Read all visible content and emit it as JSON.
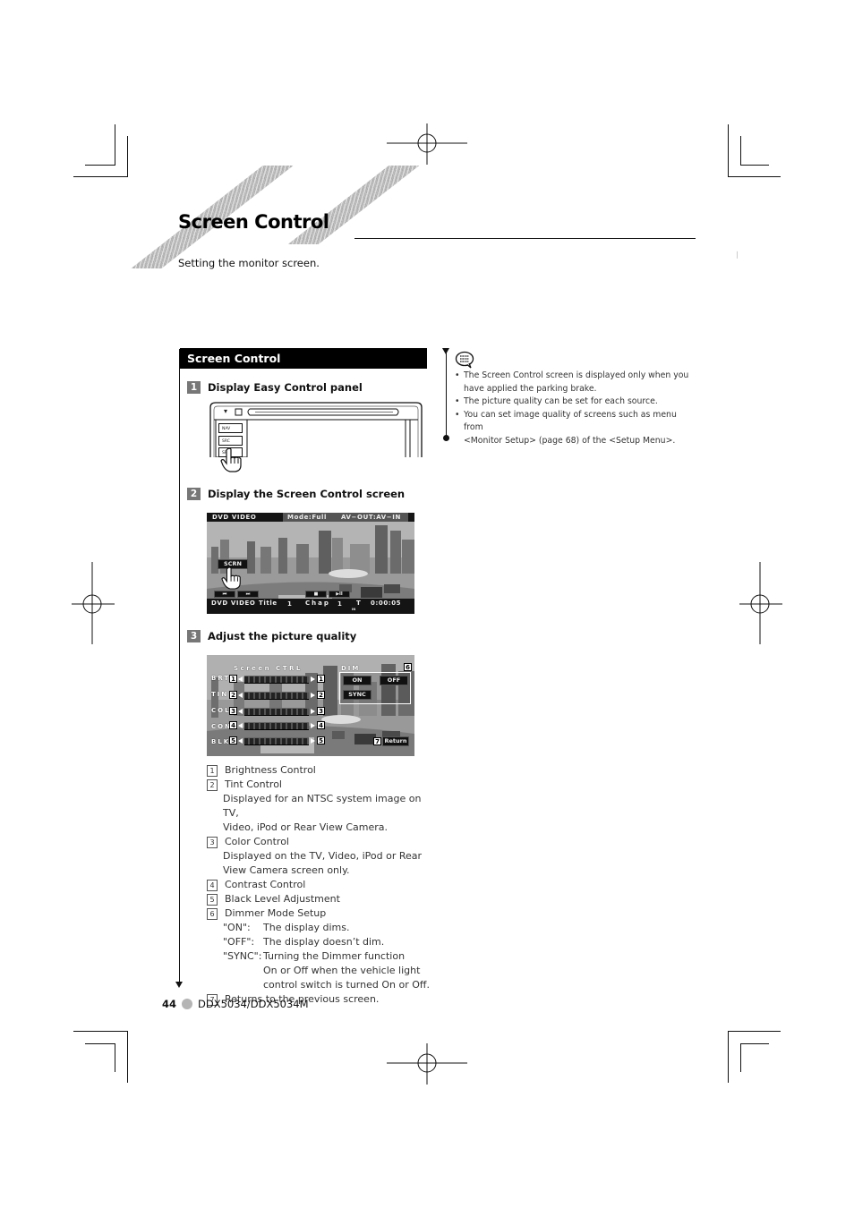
{
  "page": {
    "title": "Screen Control",
    "subtitle": "Setting the monitor screen.",
    "page_number": "44",
    "model": "DDX5034/DDX5034M",
    "margin_mark": "ᛁ"
  },
  "section": {
    "header": "Screen Control",
    "steps": [
      {
        "number": "1",
        "label": "Display Easy Control panel"
      },
      {
        "number": "2",
        "label": "Display the Screen Control screen"
      },
      {
        "number": "3",
        "label": "Adjust the picture quality"
      }
    ]
  },
  "device_panel": {
    "buttons": [
      "NAV",
      "SRC",
      "SRC"
    ],
    "eject_symbol": "▾"
  },
  "playback_screen": {
    "top_bar": {
      "source": "DVD VIDEO",
      "mode": "Mode:Full",
      "av": "AV−OUT:AV−IN"
    },
    "scrn_button": "SCRN",
    "controls": {
      "prev": "⏮",
      "next": "⏭",
      "stop": "■",
      "play_pause": "▶II"
    },
    "bottom_bar": {
      "source": "DVD VIDEO",
      "title_label": "Title",
      "title_value": "1",
      "chap_label": "Chap",
      "chap_value": "1",
      "t_label": "T",
      "time": "0:00:05",
      "indicator": "IN"
    }
  },
  "control_screen": {
    "title": "Screen CTRL",
    "controls": [
      {
        "label": "BRT",
        "num": "1"
      },
      {
        "label": "TIN",
        "num": "2"
      },
      {
        "label": "COL",
        "num": "3"
      },
      {
        "label": "CON",
        "num": "4"
      },
      {
        "label": "BLK",
        "num": "5"
      }
    ],
    "dim": {
      "label": "DIM",
      "num": "6",
      "on": "ON",
      "off": "OFF",
      "sync": "SYNC"
    },
    "return": {
      "num": "7",
      "label": "Return"
    }
  },
  "legend": [
    {
      "num": "1",
      "title": "Brightness Control",
      "desc": []
    },
    {
      "num": "2",
      "title": "Tint Control",
      "desc": [
        "Displayed for an NTSC system image on TV,",
        "Video, iPod or Rear View Camera."
      ]
    },
    {
      "num": "3",
      "title": "Color Control",
      "desc": [
        "Displayed on the TV, Video, iPod or Rear",
        "View Camera screen only."
      ]
    },
    {
      "num": "4",
      "title": "Contrast Control",
      "desc": []
    },
    {
      "num": "5",
      "title": "Black Level Adjustment",
      "desc": []
    },
    {
      "num": "6",
      "title": "Dimmer Mode Setup",
      "options": [
        {
          "key": "\"ON\":",
          "text": [
            "The display dims."
          ]
        },
        {
          "key": "\"OFF\":",
          "text": [
            "The display doesn’t dim."
          ]
        },
        {
          "key": "\"SYNC\":",
          "text": [
            "Turning the Dimmer function",
            "On or Off when the vehicle light",
            "control switch is turned On or Off."
          ]
        }
      ]
    },
    {
      "num": "7",
      "title": "Returns to the previous screen.",
      "desc": []
    }
  ],
  "notes": {
    "icon": "note-speech-bubble-icon",
    "items": [
      [
        "The Screen Control screen is displayed only when you",
        "have applied the parking brake."
      ],
      [
        "The picture quality can be set for each source."
      ],
      [
        "You can set image quality of screens such as menu from",
        "<Monitor Setup> (page 68) of the <Setup Menu>."
      ]
    ]
  }
}
